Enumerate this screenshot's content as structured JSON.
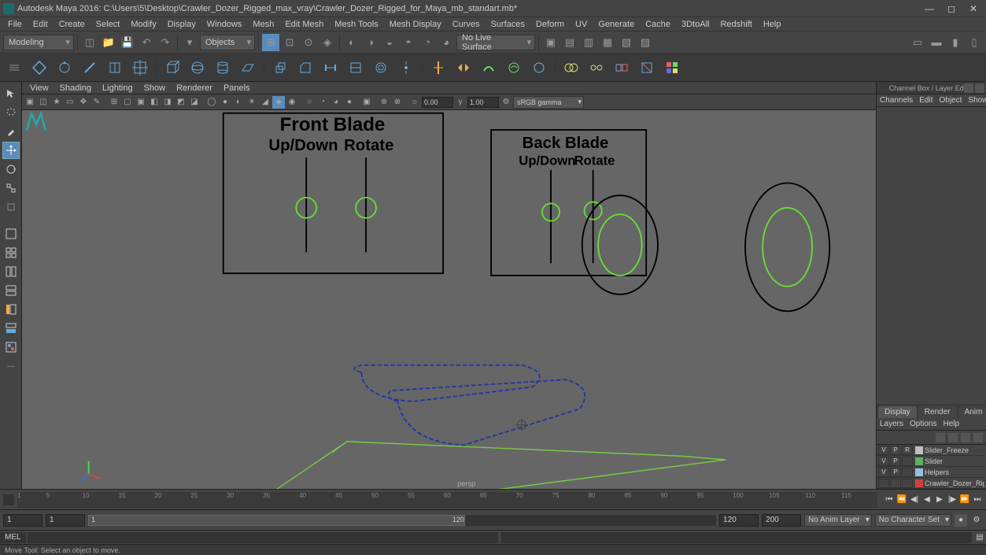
{
  "title": "Autodesk Maya 2016: C:\\Users\\5\\Desktop\\Crawler_Dozer_Rigged_max_vray\\Crawler_Dozer_Rigged_for_Maya_mb_standart.mb*",
  "menubar": [
    "File",
    "Edit",
    "Create",
    "Select",
    "Modify",
    "Display",
    "Windows",
    "Mesh",
    "Edit Mesh",
    "Mesh Tools",
    "Mesh Display",
    "Curves",
    "Surfaces",
    "Deform",
    "UV",
    "Generate",
    "Cache",
    "3DtoAll",
    "Redshift",
    "Help"
  ],
  "workspace": "Modeling",
  "mask_mode": "Objects",
  "surface_mode": "No Live Surface",
  "panel_menu": [
    "View",
    "Shading",
    "Lighting",
    "Show",
    "Renderer",
    "Panels"
  ],
  "exposure": "0.00",
  "gamma": "1.00",
  "color_space": "sRGB gamma",
  "camera_label": "persp",
  "channelbox": {
    "title": "Channel Box / Layer Editor",
    "menu": [
      "Channels",
      "Edit",
      "Object",
      "Show"
    ],
    "tabs": [
      "Display",
      "Render",
      "Anim"
    ],
    "submenu": [
      "Layers",
      "Options",
      "Help"
    ],
    "header": [
      "V",
      "P",
      "R"
    ],
    "layers": [
      {
        "v": "V",
        "p": "P",
        "r": "R",
        "color": "#c0c0c0",
        "name": "Slider_Freeze"
      },
      {
        "v": "V",
        "p": "P",
        "r": "",
        "color": "#60b060",
        "name": "Slider"
      },
      {
        "v": "V",
        "p": "P",
        "r": "",
        "color": "#90c0e0",
        "name": "Helpers"
      },
      {
        "v": "",
        "p": "",
        "r": "",
        "color": "#d04040",
        "name": "Crawler_Dozer_Rigged"
      }
    ]
  },
  "timeline": {
    "ticks": [
      1,
      5,
      10,
      15,
      20,
      25,
      30,
      35,
      40,
      45,
      50,
      55,
      60,
      65,
      70,
      75,
      80,
      85,
      90,
      95,
      100,
      105,
      110,
      115,
      120
    ]
  },
  "range": {
    "start": "1",
    "display_start": "1",
    "cursor": "1",
    "display_end": "120",
    "end": "120",
    "total": "200",
    "anim_layer": "No Anim Layer",
    "char_set": "No Character Set"
  },
  "cmd_label": "MEL",
  "help_text": "Move Tool: Select an object to move.",
  "viewport_text": {
    "front_title": "Front Blade",
    "front_up": "Up/Down",
    "front_rot": "Rotate",
    "back_title": "Back Blade",
    "back_up": "Up/Down",
    "back_rot": "Rotate"
  }
}
